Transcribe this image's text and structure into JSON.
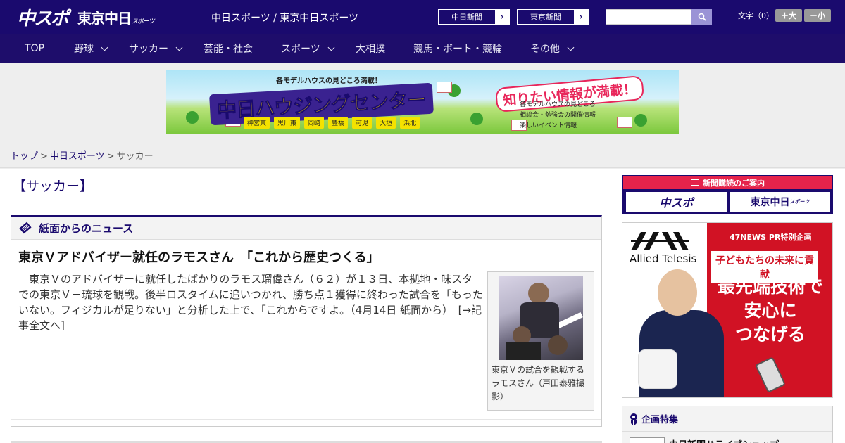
{
  "header": {
    "logo_main": "中スポ",
    "logo_sub": "東京中日",
    "logo_sub_suffix": "スポーツ",
    "title": "中日スポーツ / 東京中日スポーツ",
    "link_buttons": [
      {
        "label": "中日新聞",
        "arrow": "›"
      },
      {
        "label": "東京新聞",
        "arrow": "›"
      }
    ],
    "search": {
      "placeholder": "",
      "value": ""
    },
    "font_size_label": "文字（0）",
    "font_larger_label": "＋大",
    "font_smaller_label": "－小"
  },
  "nav": {
    "items": [
      {
        "label": "TOP"
      },
      {
        "label": "野球"
      },
      {
        "label": "サッカー"
      },
      {
        "label": "芸能・社会"
      },
      {
        "label": "スポーツ"
      },
      {
        "label": "大相撲"
      },
      {
        "label": "競馬・ボート・競輪"
      },
      {
        "label": "その他"
      }
    ]
  },
  "banner": {
    "subtitle": "各モデルハウスの見どころ満載！",
    "title": "中日ハウジングセンター",
    "catch": "知りたい情報が満載！",
    "cities": [
      "神宮東",
      "黒川東",
      "岡崎",
      "豊橋",
      "可児",
      "大垣",
      "浜北"
    ],
    "info": [
      "各モデルハウスの見どころ",
      "相談会・勉強会の開催情報",
      "楽しいイベント情報"
    ]
  },
  "breadcrumb": {
    "items": [
      "トップ",
      "中日スポーツ",
      "サッカー"
    ],
    "separator": ">"
  },
  "page": {
    "title": "【サッカー】"
  },
  "news": {
    "section_title": "紙面からのニュース",
    "article": {
      "title": "東京Ｖアドバイザー就任のラモスさん　「これから歴史つくる」",
      "body": "東京Ｖのアドバイザーに就任したばかりのラモス瑠偉さん（６２）が１３日、本拠地・味スタでの東京Ｖ－琉球を観戦。後半ロスタイムに追いつかれ、勝ち点１獲得に終わった試合を「もったいない。フィジカルが足りない」と分析した上で、「これからですよ。（4月14日 紙面から）",
      "more_link": "[→記事全文へ]",
      "caption": "東京Ｖの試合を観戦するラモスさん（戸田泰雅撮影）"
    }
  },
  "sidebar": {
    "subscribe": {
      "header": "新聞購読のご案内",
      "logo_1": "中スポ",
      "logo_2": "東京中日",
      "logo_2_suffix": "スポーツ"
    },
    "ad": {
      "label": "47NEWS PR特別企画",
      "lead": "子どもたちの未来に貢献",
      "headline_lines": [
        "最先端技術で",
        "安心に",
        "つなげる"
      ],
      "brand": "Allied Telesis"
    },
    "feature": {
      "title": "企画特集",
      "item": "中日新聞ドライブショップ"
    }
  }
}
